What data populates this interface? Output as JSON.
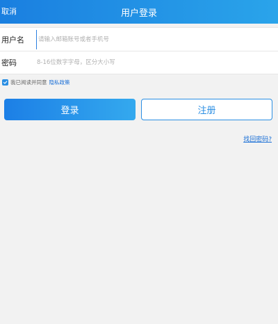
{
  "header": {
    "cancel_label": "取消",
    "title": "用户登录"
  },
  "form": {
    "username_label": "用户名",
    "username_placeholder": "请输入邮箱账号或者手机号",
    "password_label": "密码",
    "password_placeholder": "8-16位数字字母，区分大小写"
  },
  "agreement": {
    "checked": true,
    "text": "我已阅读并同意",
    "privacy_link": "隐私政策"
  },
  "buttons": {
    "login_label": "登录",
    "register_label": "注册"
  },
  "forgot_password_label": "找回密码?",
  "colors": {
    "accent": "#2a8ee3",
    "link": "#1a6fd6",
    "background": "#f2f2f2"
  },
  "icons": {
    "checkbox": "check-icon"
  }
}
